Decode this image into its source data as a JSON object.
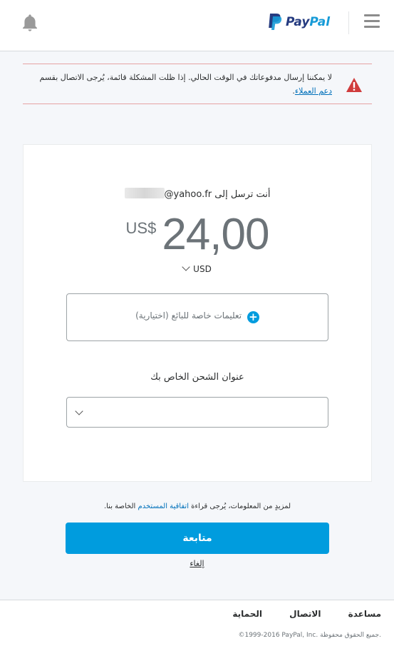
{
  "header": {
    "logo_text_1": "Pay",
    "logo_text_2": "Pal",
    "icons": {
      "notifications": "bell-icon",
      "menu": "hamburger-menu-icon",
      "logo": "paypal-logo"
    }
  },
  "alert": {
    "message": "لا يمكننا إرسال مدفوعاتك في الوقت الحالي. إذا ظلت المشكلة قائمة، يُرجى الاتصال بقسم",
    "link": "دعم العملاء",
    "tail": ".",
    "icon": "warning-icon",
    "color": "#d03c3c"
  },
  "payment": {
    "recipient_label": "أنت ترسل إلى",
    "recipient_email": "@yahoo.fr",
    "currency_symbol": "US$",
    "amount": "24,00",
    "currency_code": "USD",
    "note_placeholder": "تعليمات خاصة للبائع (اختيارية)",
    "shipping_label": "عنوان الشحن الخاص بك",
    "shipping_value": ""
  },
  "agreement": {
    "prefix": "لمزيدٍ من المعلومات، يُرجى قراءة",
    "link": "اتفاقية المستخدم",
    "suffix": "الخاصة بنا."
  },
  "actions": {
    "continue": "متابعة",
    "cancel": "إلغاء",
    "primary_color": "#009cde"
  },
  "footer": {
    "links": [
      "مساعدة",
      "الاتصال",
      "الحماية"
    ],
    "copyright": "©1999-2016 PayPal, Inc. جميع الحقوق محفوظة."
  }
}
